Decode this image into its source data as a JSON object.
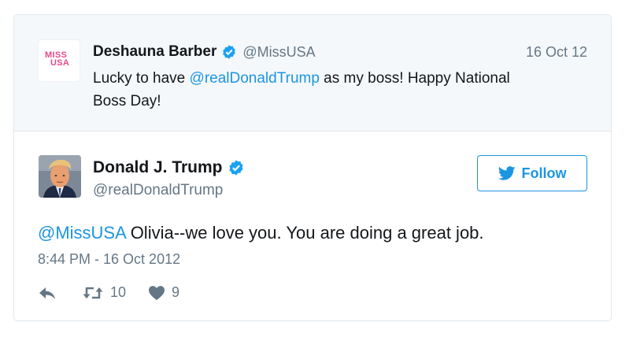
{
  "quoted": {
    "name": "Deshauna Barber",
    "handle": "@MissUSA",
    "date": "16 Oct 12",
    "text_before": "Lucky to have ",
    "mention": "@realDonaldTrump",
    "text_after": " as my boss! Happy National Boss Day!",
    "logo_line1": "MISS",
    "logo_line2": "USA"
  },
  "tweet": {
    "name": "Donald J. Trump",
    "handle": "@realDonaldTrump",
    "follow_label": "Follow",
    "mention": "@MissUSA",
    "text": " Olivia--we love you. You are doing a great job.",
    "timestamp": "8:44 PM - 16 Oct 2012",
    "retweets": "10",
    "likes": "9"
  },
  "colors": {
    "accent": "#1b95e0",
    "muted": "#657786",
    "quoted_bg": "#f5f8fa",
    "logo_pink": "#e8498a"
  },
  "icons": [
    "verified-badge-icon",
    "twitter-bird-icon",
    "reply-icon",
    "retweet-icon",
    "heart-icon"
  ]
}
